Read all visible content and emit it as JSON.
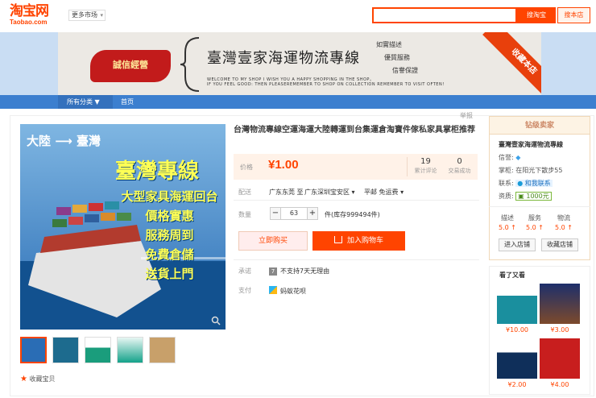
{
  "header": {
    "logo_cn": "淘宝网",
    "logo_en": "Taobao.com",
    "market": "更多市场",
    "search_btn": "搜淘宝",
    "shop_btn": "搜本店",
    "search_placeholder": ""
  },
  "banner": {
    "badge": "誠信經營",
    "title": "臺灣壹家海運物流專線",
    "sub1": "WELCOME TO MY SHOP I WISH YOU A HAPPY SHOPPING IN THE SHOP。",
    "sub2": "IF YOU FEEL GOOD:  THEN PLEASEREMEMBER TO SHOP ON COLLECTION REMEMBER TO VISIT OFTEN!",
    "word1": "如實描述",
    "word2": "優質服務",
    "word3": "信譽保證",
    "ribbon": "收藏本店"
  },
  "nav": {
    "category": "所有分类",
    "home": "首页"
  },
  "report": "举报",
  "image": {
    "route": "大陸 ⟶ 臺灣",
    "headline": "臺灣專線",
    "lines": [
      "大型家具海運回台",
      "價格實惠",
      "服務周到",
      "免費倉儲",
      "送貨上門"
    ]
  },
  "favorite": "收藏宝贝",
  "product": {
    "title": "台灣物流專線空運海運大陸轉運到台集運倉淘寶件傢私家具掌柜推荐",
    "price_label": "价格",
    "price": "¥1.00",
    "reviews_count": "19",
    "reviews_label": "累计评论",
    "sales_count": "0",
    "sales_label": "交易成功",
    "delivery_label": "配送",
    "delivery_from": "广东东莞 至",
    "delivery_to": "广东深圳宝安区",
    "delivery_type": "平邮 免运费",
    "qty_label": "数量",
    "qty_value": "63",
    "stock": "件(库存999494件)",
    "buy_now": "立即购买",
    "add_cart": "加入购物车",
    "promise_label": "承诺",
    "promise_badge": "7",
    "promise_text": "不支持7天无理由",
    "pay_label": "支付",
    "pay_text": "蚂蚁花呗"
  },
  "seller": {
    "head": "钻级卖家",
    "shop_name": "臺灣壹家海運物流專線",
    "credit_label": "信誉:",
    "owner_label": "掌柜:",
    "owner": "在阳光下散步55",
    "contact_label": "联系:",
    "contact": "和我联系",
    "deposit_label": "资质:",
    "deposit": "1000元",
    "score_desc_label": "描述",
    "score_desc": "5.0",
    "score_service_label": "服务",
    "score_service": "5.0",
    "score_logistics_label": "物流",
    "score_logistics": "5.0",
    "enter_shop": "进入店铺",
    "fav_shop": "收藏店铺"
  },
  "also": {
    "title": "看了又看",
    "items": [
      {
        "price": "¥10.00"
      },
      {
        "price": "¥3.00"
      },
      {
        "price": "¥2.00"
      },
      {
        "price": "¥4.00"
      }
    ]
  },
  "colors": {
    "accent": "#ff4400",
    "nav": "#3c7fcf",
    "price_bg": "#fff2e8"
  }
}
